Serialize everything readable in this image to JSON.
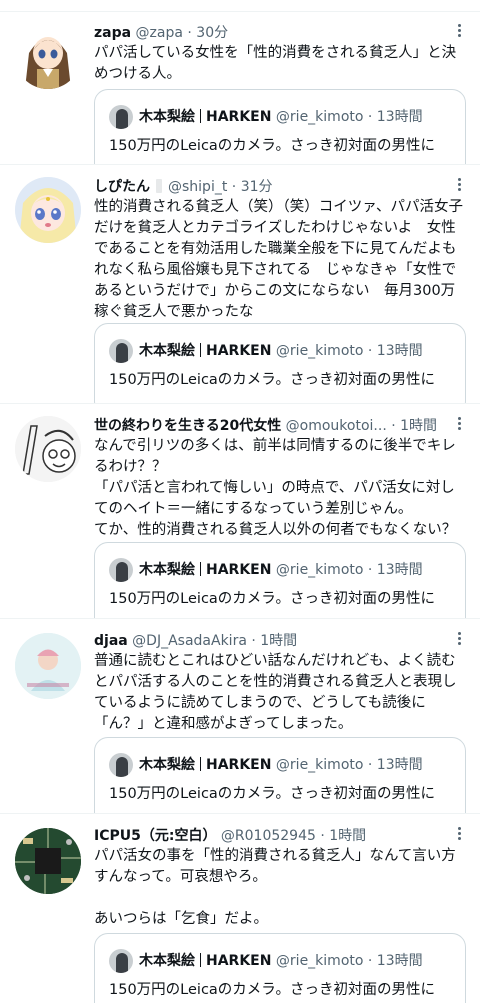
{
  "quote": {
    "name_part1": "木本梨絵",
    "name_part2": "HARKEN",
    "handle": "@rie_kimoto",
    "time": "13時間",
    "dot": "·",
    "text": "150万円のLeicaのカメラ。さっき初対面の男性に"
  },
  "tweets": [
    {
      "name": "zapa",
      "handle": "@zapa",
      "dot": "·",
      "time": "30分",
      "text": "パパ活している女性を「性的消費をされる貧乏人」と決めつける人。"
    },
    {
      "name": "しぴたん",
      "handle": "@shipi_t",
      "dot": "·",
      "time": "31分",
      "text": "性的消費される貧乏人（笑）（笑）コイツァ、パパ活女子だけを貧乏人とカテゴライズしたわけじゃないよ　女性であることを有効活用した職業全般を下に見てんだよもれなく私ら風俗嬢も見下されてる　じゃなきゃ「女性であるというだけで」からこの文にならない　毎月300万稼ぐ貧乏人で悪かったな"
    },
    {
      "name": "世の終わりを生きる20代女性",
      "handle": "@omoukotoi...",
      "dot": "·",
      "time": "1時間",
      "text": "なんで引リツの多くは、前半は同情するのに後半でキレるわけ？？\n「パパ活と言われて悔しい」の時点で、パパ活女に対してのヘイト＝一緒にするなっていう差別じゃん。\nてか、性的消費される貧乏人以外の何者でもなくない？"
    },
    {
      "name": "djaa",
      "handle": "@DJ_AsadaAkira",
      "dot": "·",
      "time": "1時間",
      "text": "普通に読むとこれはひどい話なんだけれども、よく読むとパパ活する人のことを性的消費される貧乏人と表現しているように読めてしまうので、どうしても読後に「ん？」と違和感がよぎってしまった。"
    },
    {
      "name": "ICPU5（元:空白）",
      "handle": "@R01052945",
      "dot": "·",
      "time": "1時間",
      "text": "パパ活女の事を「性的消費される貧乏人」なんて言い方すんなって。可哀想やろ。\n\nあいつらは「乞食」だよ。"
    }
  ]
}
